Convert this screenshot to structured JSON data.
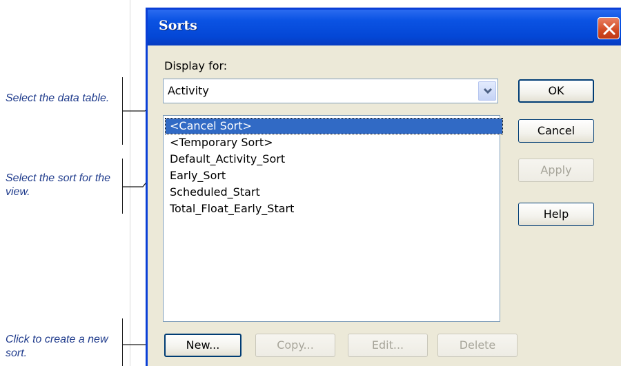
{
  "callouts": {
    "select_table": "Select the data table.",
    "select_sort": "Select the sort for the view.",
    "create_sort": "Click to create a new sort."
  },
  "dialog": {
    "title": "Sorts",
    "display_for_label": "Display for:",
    "display_for_value": "Activity",
    "sorts": [
      "<Cancel Sort>",
      "<Temporary Sort>",
      "Default_Activity_Sort",
      "Early_Sort",
      "Scheduled_Start",
      "Total_Float_Early_Start"
    ],
    "selected_index": 0,
    "buttons": {
      "ok": "OK",
      "cancel": "Cancel",
      "apply": "Apply",
      "help": "Help",
      "new": "New...",
      "copy": "Copy...",
      "edit": "Edit...",
      "delete": "Delete"
    }
  },
  "icons": {
    "close": "close-icon",
    "dropdown": "chevron-down-icon"
  },
  "colors": {
    "titlebar": "#0447d6",
    "close_button": "#d24a23",
    "selection": "#316ac5",
    "callout_text": "#1f3b8c"
  }
}
